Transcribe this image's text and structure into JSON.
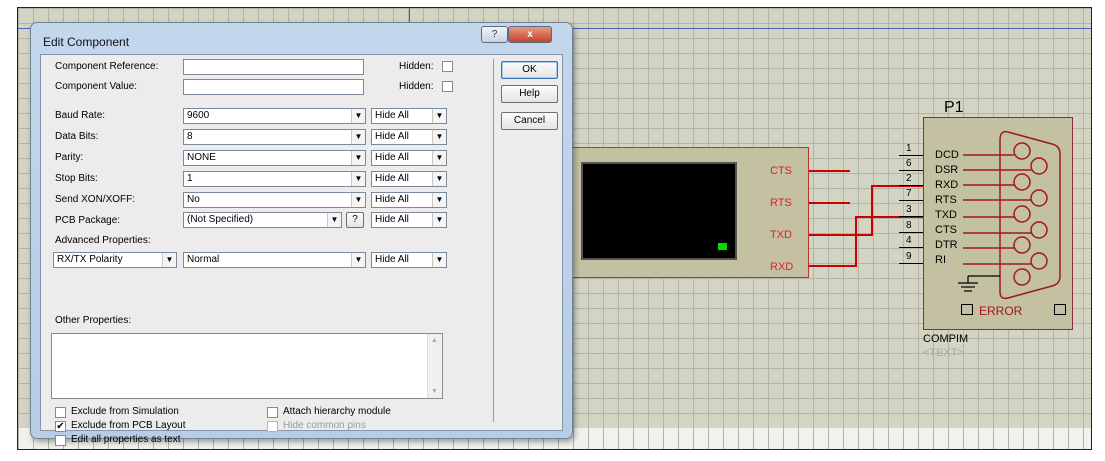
{
  "dialog": {
    "title": "Edit Component",
    "help_glyph": "?",
    "close_glyph": "x",
    "component_reference_label": "Component Reference:",
    "component_reference_value": "",
    "component_value_label": "Component Value:",
    "component_value_value": "",
    "hidden_label": "Hidden:",
    "properties": [
      {
        "label": "Baud Rate:",
        "value": "9600",
        "visibility": "Hide All"
      },
      {
        "label": "Data Bits:",
        "value": "8",
        "visibility": "Hide All"
      },
      {
        "label": "Parity:",
        "value": "NONE",
        "visibility": "Hide All"
      },
      {
        "label": "Stop Bits:",
        "value": "1",
        "visibility": "Hide All"
      },
      {
        "label": "Send XON/XOFF:",
        "value": "No",
        "visibility": "Hide All"
      },
      {
        "label": "PCB Package:",
        "value": "(Not Specified)",
        "visibility": "Hide All"
      }
    ],
    "pcb_help_glyph": "?",
    "advanced_label": "Advanced Properties:",
    "advanced_property": "RX/TX Polarity",
    "advanced_value": "Normal",
    "advanced_visibility": "Hide All",
    "other_label": "Other Properties:",
    "checkboxes": {
      "exclude_sim": "Exclude from Simulation",
      "exclude_pcb": "Exclude from PCB Layout",
      "edit_all": "Edit all properties as text",
      "attach_hier": "Attach hierarchy module",
      "hide_common": "Hide common pins"
    },
    "buttons": {
      "ok": "OK",
      "help": "Help",
      "cancel": "Cancel"
    }
  },
  "schematic": {
    "terminal_pins": [
      "CTS",
      "RTS",
      "TXD",
      "RXD"
    ],
    "connector": {
      "ref": "P1",
      "pin_numbers": [
        "1",
        "6",
        "2",
        "7",
        "3",
        "8",
        "4",
        "9"
      ],
      "pin_names": [
        "DCD",
        "DSR",
        "RXD",
        "RTS",
        "TXD",
        "CTS",
        "DTR",
        "RI"
      ],
      "error_label": "ERROR",
      "part_name": "COMPIM",
      "text_placeholder": "<TEXT>"
    }
  },
  "colors": {
    "wire": "#cc0000",
    "led": "#00e000",
    "dialog_frame": "#b7cce6"
  }
}
